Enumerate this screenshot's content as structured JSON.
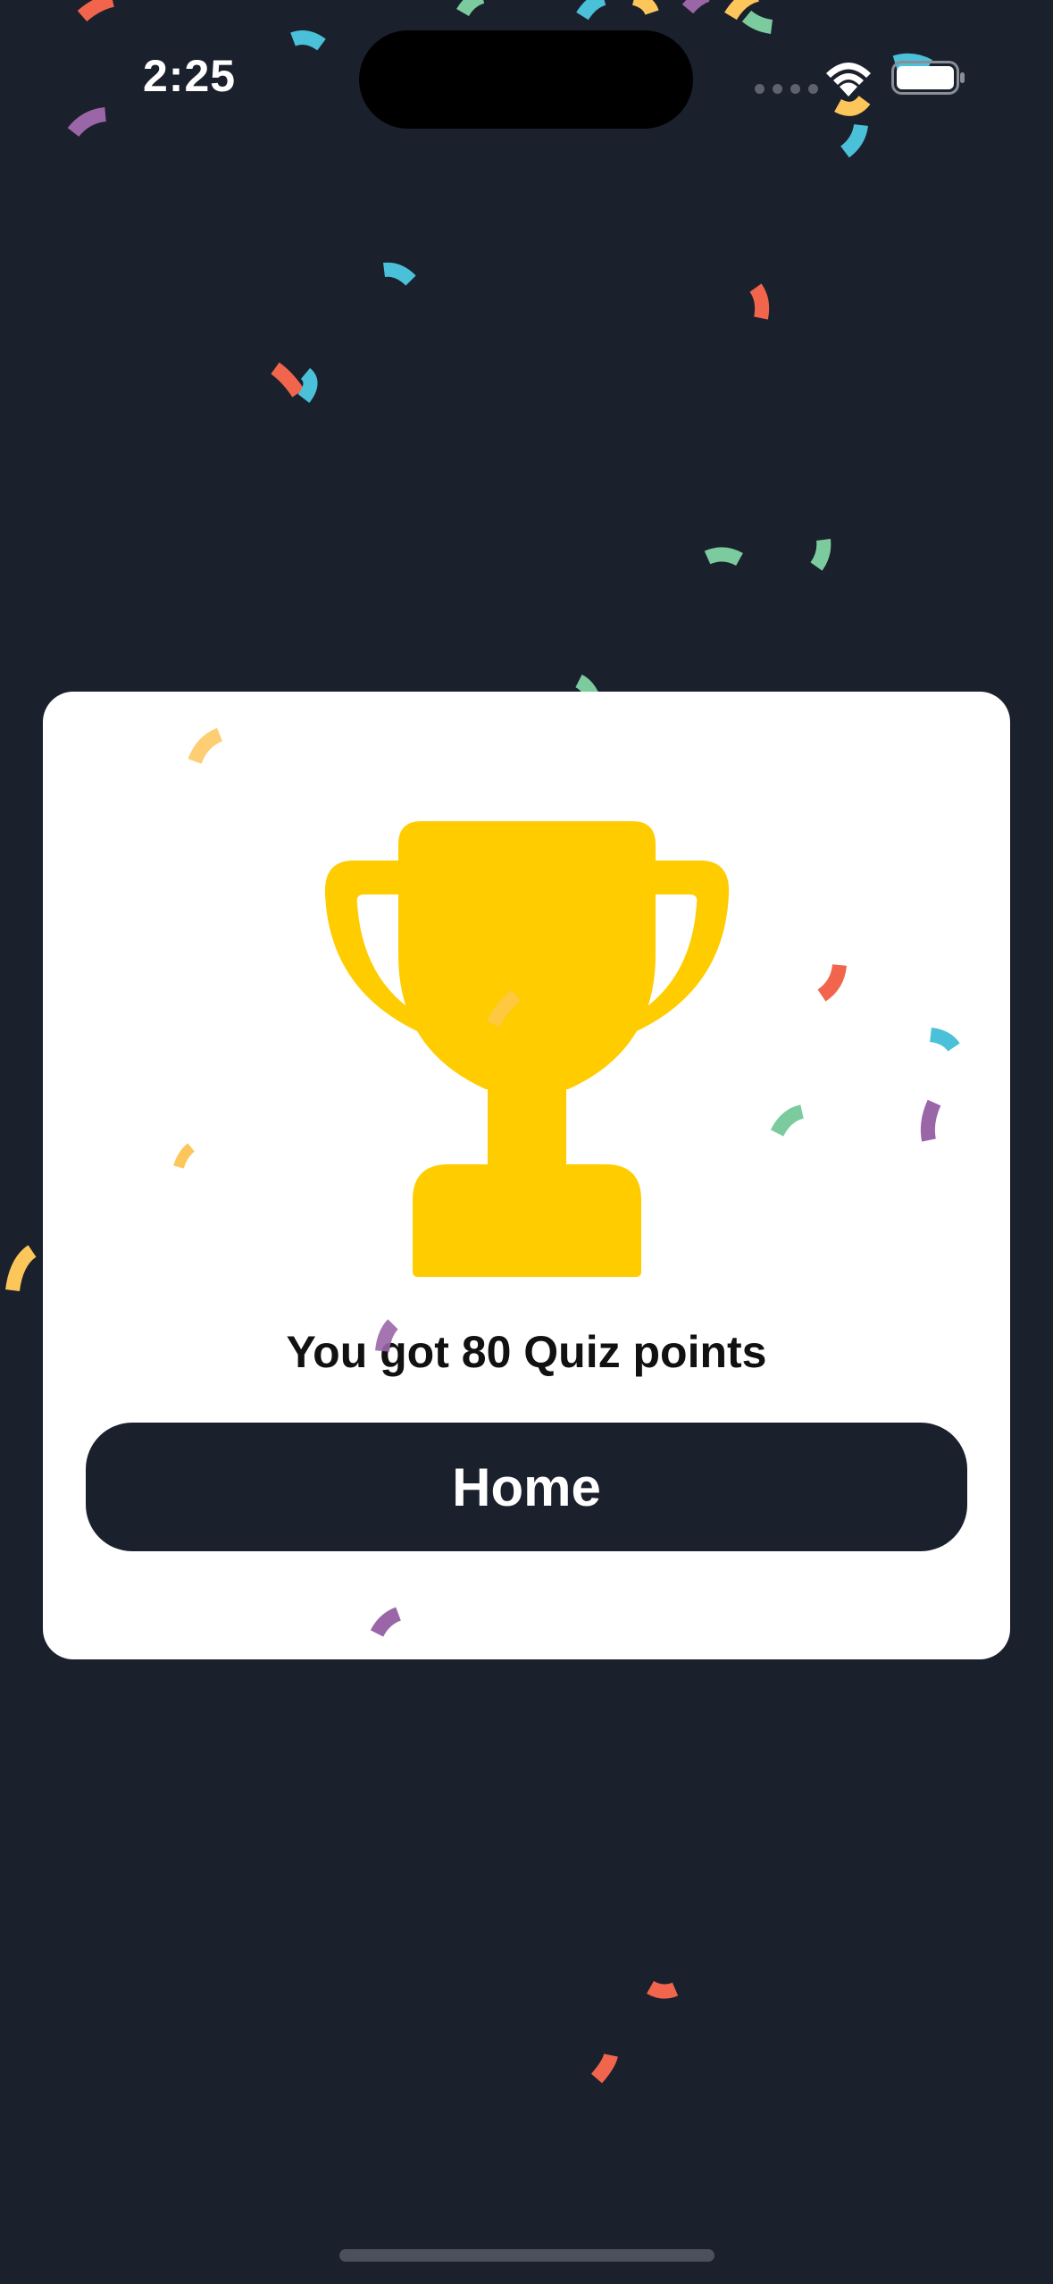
{
  "status_bar": {
    "time": "2:25"
  },
  "result": {
    "message": "You got 80 Quiz points",
    "trophy_icon": "trophy-icon",
    "trophy_color": "#FFCC00"
  },
  "home_button": {
    "label": "Home"
  },
  "colors": {
    "background": "#1B202D",
    "card": "#FFFFFF",
    "button": "#1B202D",
    "confetti": [
      "#F0654C",
      "#4BC0D9",
      "#7CCB9E",
      "#9A66A8",
      "#FDC65A"
    ]
  }
}
